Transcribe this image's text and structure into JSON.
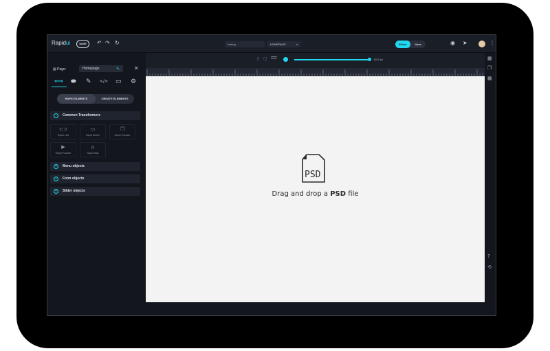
{
  "app": {
    "logo_main": "Rapid",
    "logo_accent": "ui",
    "save_label": "SAVE",
    "project_field": "testing",
    "page_select": "HOMEPAGE",
    "mode_editor": "Editor",
    "mode_user": "User"
  },
  "icons": {
    "undo": "↶",
    "redo": "↷",
    "refresh": "↻",
    "eye": "◉",
    "send": "➤",
    "menu": "⋮",
    "close": "✕",
    "chevron": "▾",
    "page": "▤",
    "arrows": "⟺",
    "eraser": "⬬",
    "brush": "✎",
    "code": "</>",
    "monitor": "▭",
    "gear": "⚙",
    "minus": "–",
    "plus": "+",
    "link": "⊂⊃",
    "button": "▭",
    "parallax": "❐",
    "youtube": "▶",
    "map": "⌂",
    "desktop": "▢",
    "tablet": "▯",
    "layers": "▦",
    "help": "?",
    "history": "⟲"
  },
  "left_panel": {
    "page_label": "Page:",
    "page_value": "Homepage",
    "tab_rapid": "RAPID ELMENTS",
    "tab_create": "CREATE ELEMENTS",
    "sections": [
      {
        "label": "Common Transformers"
      },
      {
        "label": "Menu objects"
      },
      {
        "label": "Form objects"
      },
      {
        "label": "Slider objects"
      }
    ],
    "elements": [
      {
        "label": "Rapid Link"
      },
      {
        "label": "Rapid Button"
      },
      {
        "label": "Rapid Parallax"
      },
      {
        "label": "Rapid Youtube"
      },
      {
        "label": "Rapid Map"
      }
    ]
  },
  "toolbar": {
    "width_value": "1920 px"
  },
  "canvas": {
    "psd_label": "PSD",
    "drop_prefix": "Drag and drop a ",
    "drop_bold": "PSD",
    "drop_suffix": " file"
  },
  "colors": {
    "accent": "#22d8f0",
    "panel": "#13161d",
    "bar": "#1a1e27",
    "canvas": "#f3f3f3"
  }
}
